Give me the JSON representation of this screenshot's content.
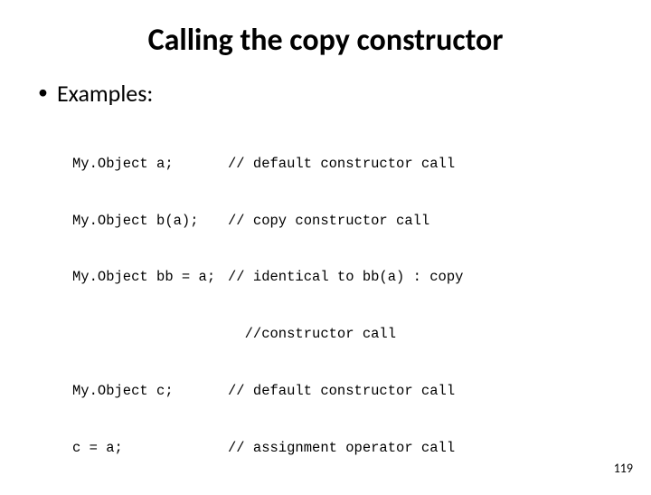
{
  "title": "Calling the copy constructor",
  "bullet": "Examples:",
  "code": {
    "l1_left": "My.Object a;",
    "l1_right": "// default constructor call",
    "l2_left": "My.Object b(a);",
    "l2_right": "// copy constructor call",
    "l3_left": "My.Object bb = a;",
    "l3_right": "// identical to bb(a) : copy",
    "l4_left": "",
    "l4_right": "  //constructor call",
    "l5_left": "My.Object c;",
    "l5_right": "// default constructor call",
    "l6_left": "c = a;",
    "l6_right": "// assignment operator call"
  },
  "page_number": "119"
}
